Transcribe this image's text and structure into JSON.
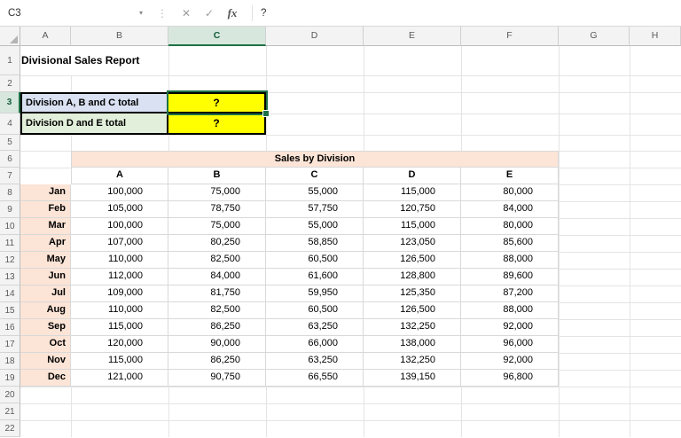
{
  "formula_bar": {
    "name_box": "C3",
    "dropdown_icon": "▾",
    "separator_icon": "⋮",
    "cancel_icon": "✕",
    "enter_icon": "✓",
    "fx_icon": "fx",
    "formula": "?"
  },
  "columns": [
    "A",
    "B",
    "C",
    "D",
    "E",
    "F",
    "G",
    "H"
  ],
  "row_numbers": [
    "1",
    "2",
    "3",
    "4",
    "5",
    "6",
    "7",
    "8",
    "9",
    "10",
    "11",
    "12",
    "13",
    "14",
    "15",
    "16",
    "17",
    "18",
    "19",
    "20",
    "21",
    "22"
  ],
  "selection": {
    "cell": "C3"
  },
  "sheet_title": "Divisional Sales Report",
  "summary": {
    "rows": [
      {
        "label": "Division A, B and C total",
        "value": "?"
      },
      {
        "label": "Division D and E total",
        "value": "?"
      }
    ]
  },
  "table": {
    "title": "Sales by Division",
    "headers": [
      "A",
      "B",
      "C",
      "D",
      "E"
    ],
    "rows": [
      {
        "month": "Jan",
        "values": [
          "100,000",
          "75,000",
          "55,000",
          "115,000",
          "80,000"
        ]
      },
      {
        "month": "Feb",
        "values": [
          "105,000",
          "78,750",
          "57,750",
          "120,750",
          "84,000"
        ]
      },
      {
        "month": "Mar",
        "values": [
          "100,000",
          "75,000",
          "55,000",
          "115,000",
          "80,000"
        ]
      },
      {
        "month": "Apr",
        "values": [
          "107,000",
          "80,250",
          "58,850",
          "123,050",
          "85,600"
        ]
      },
      {
        "month": "May",
        "values": [
          "110,000",
          "82,500",
          "60,500",
          "126,500",
          "88,000"
        ]
      },
      {
        "month": "Jun",
        "values": [
          "112,000",
          "84,000",
          "61,600",
          "128,800",
          "89,600"
        ]
      },
      {
        "month": "Jul",
        "values": [
          "109,000",
          "81,750",
          "59,950",
          "125,350",
          "87,200"
        ]
      },
      {
        "month": "Aug",
        "values": [
          "110,000",
          "82,500",
          "60,500",
          "126,500",
          "88,000"
        ]
      },
      {
        "month": "Sep",
        "values": [
          "115,000",
          "86,250",
          "63,250",
          "132,250",
          "92,000"
        ]
      },
      {
        "month": "Oct",
        "values": [
          "120,000",
          "90,000",
          "66,000",
          "138,000",
          "96,000"
        ]
      },
      {
        "month": "Nov",
        "values": [
          "115,000",
          "86,250",
          "63,250",
          "132,250",
          "92,000"
        ]
      },
      {
        "month": "Dec",
        "values": [
          "121,000",
          "90,750",
          "66,550",
          "139,150",
          "96,800"
        ]
      }
    ]
  },
  "colors": {
    "selection_green": "#1E7145",
    "highlight_yellow": "#FFFF00",
    "summary_blue": "#D9E1F2",
    "summary_green": "#E2EFDA",
    "table_peach": "#FCE4D6"
  }
}
